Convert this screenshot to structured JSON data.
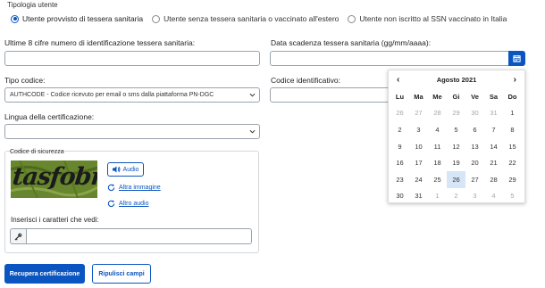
{
  "tipologia": {
    "legend": "Tipologia utente",
    "options": [
      {
        "label": "Utente provvisto di tessera sanitaria",
        "selected": true
      },
      {
        "label": "Utente senza tessera sanitaria o vaccinato all'estero",
        "selected": false
      },
      {
        "label": "Utente non iscritto al SSN vaccinato in Italia",
        "selected": false
      }
    ]
  },
  "fields": {
    "ultime8_label": "Ultime 8 cifre numero di identificazione tessera sanitaria:",
    "scadenza_label": "Data scadenza tessera sanitaria (gg/mm/aaaa):",
    "tipo_label": "Tipo codice:",
    "tipo_value": "AUTHCODE - Codice ricevuto per email o sms dalla piattaforma PN-DGC",
    "codice_label": "Codice identificativo:",
    "lingua_label": "Lingua della certificazione:",
    "lingua_value": ""
  },
  "calendar": {
    "month_label": "Agosto 2021",
    "weekdays": [
      "Lu",
      "Ma",
      "Me",
      "Gi",
      "Ve",
      "Sa",
      "Do"
    ],
    "weeks": [
      [
        {
          "d": "26",
          "out": true
        },
        {
          "d": "27",
          "out": true
        },
        {
          "d": "28",
          "out": true
        },
        {
          "d": "29",
          "out": true
        },
        {
          "d": "30",
          "out": true
        },
        {
          "d": "31",
          "out": true
        },
        {
          "d": "1",
          "out": false
        }
      ],
      [
        {
          "d": "2"
        },
        {
          "d": "3"
        },
        {
          "d": "4"
        },
        {
          "d": "5"
        },
        {
          "d": "6"
        },
        {
          "d": "7"
        },
        {
          "d": "8"
        }
      ],
      [
        {
          "d": "9"
        },
        {
          "d": "10"
        },
        {
          "d": "11"
        },
        {
          "d": "12"
        },
        {
          "d": "13"
        },
        {
          "d": "14"
        },
        {
          "d": "15"
        }
      ],
      [
        {
          "d": "16"
        },
        {
          "d": "17"
        },
        {
          "d": "18"
        },
        {
          "d": "19"
        },
        {
          "d": "20"
        },
        {
          "d": "21"
        },
        {
          "d": "22"
        }
      ],
      [
        {
          "d": "23"
        },
        {
          "d": "24"
        },
        {
          "d": "25"
        },
        {
          "d": "26",
          "today": true
        },
        {
          "d": "27"
        },
        {
          "d": "28"
        },
        {
          "d": "29"
        }
      ],
      [
        {
          "d": "30"
        },
        {
          "d": "31"
        },
        {
          "d": "1",
          "out": true
        },
        {
          "d": "2",
          "out": true
        },
        {
          "d": "3",
          "out": true
        },
        {
          "d": "4",
          "out": true
        },
        {
          "d": "5",
          "out": true
        }
      ]
    ]
  },
  "captcha": {
    "title": "Codice di sicurezza",
    "image_text": "tasfobra",
    "audio_label": "Audio",
    "altra_immagine": "Altra immagine",
    "altro_audio": "Altro audio",
    "input_label": "Inserisci i caratteri che vedi:",
    "input_value": ""
  },
  "actions": {
    "recupera": "Recupera certificazione",
    "ripulisci": "Ripulisci campi"
  },
  "colors": {
    "primary": "#0b55c0",
    "today_highlight": "#d6e6f7",
    "captcha_bg": "#67862d"
  }
}
